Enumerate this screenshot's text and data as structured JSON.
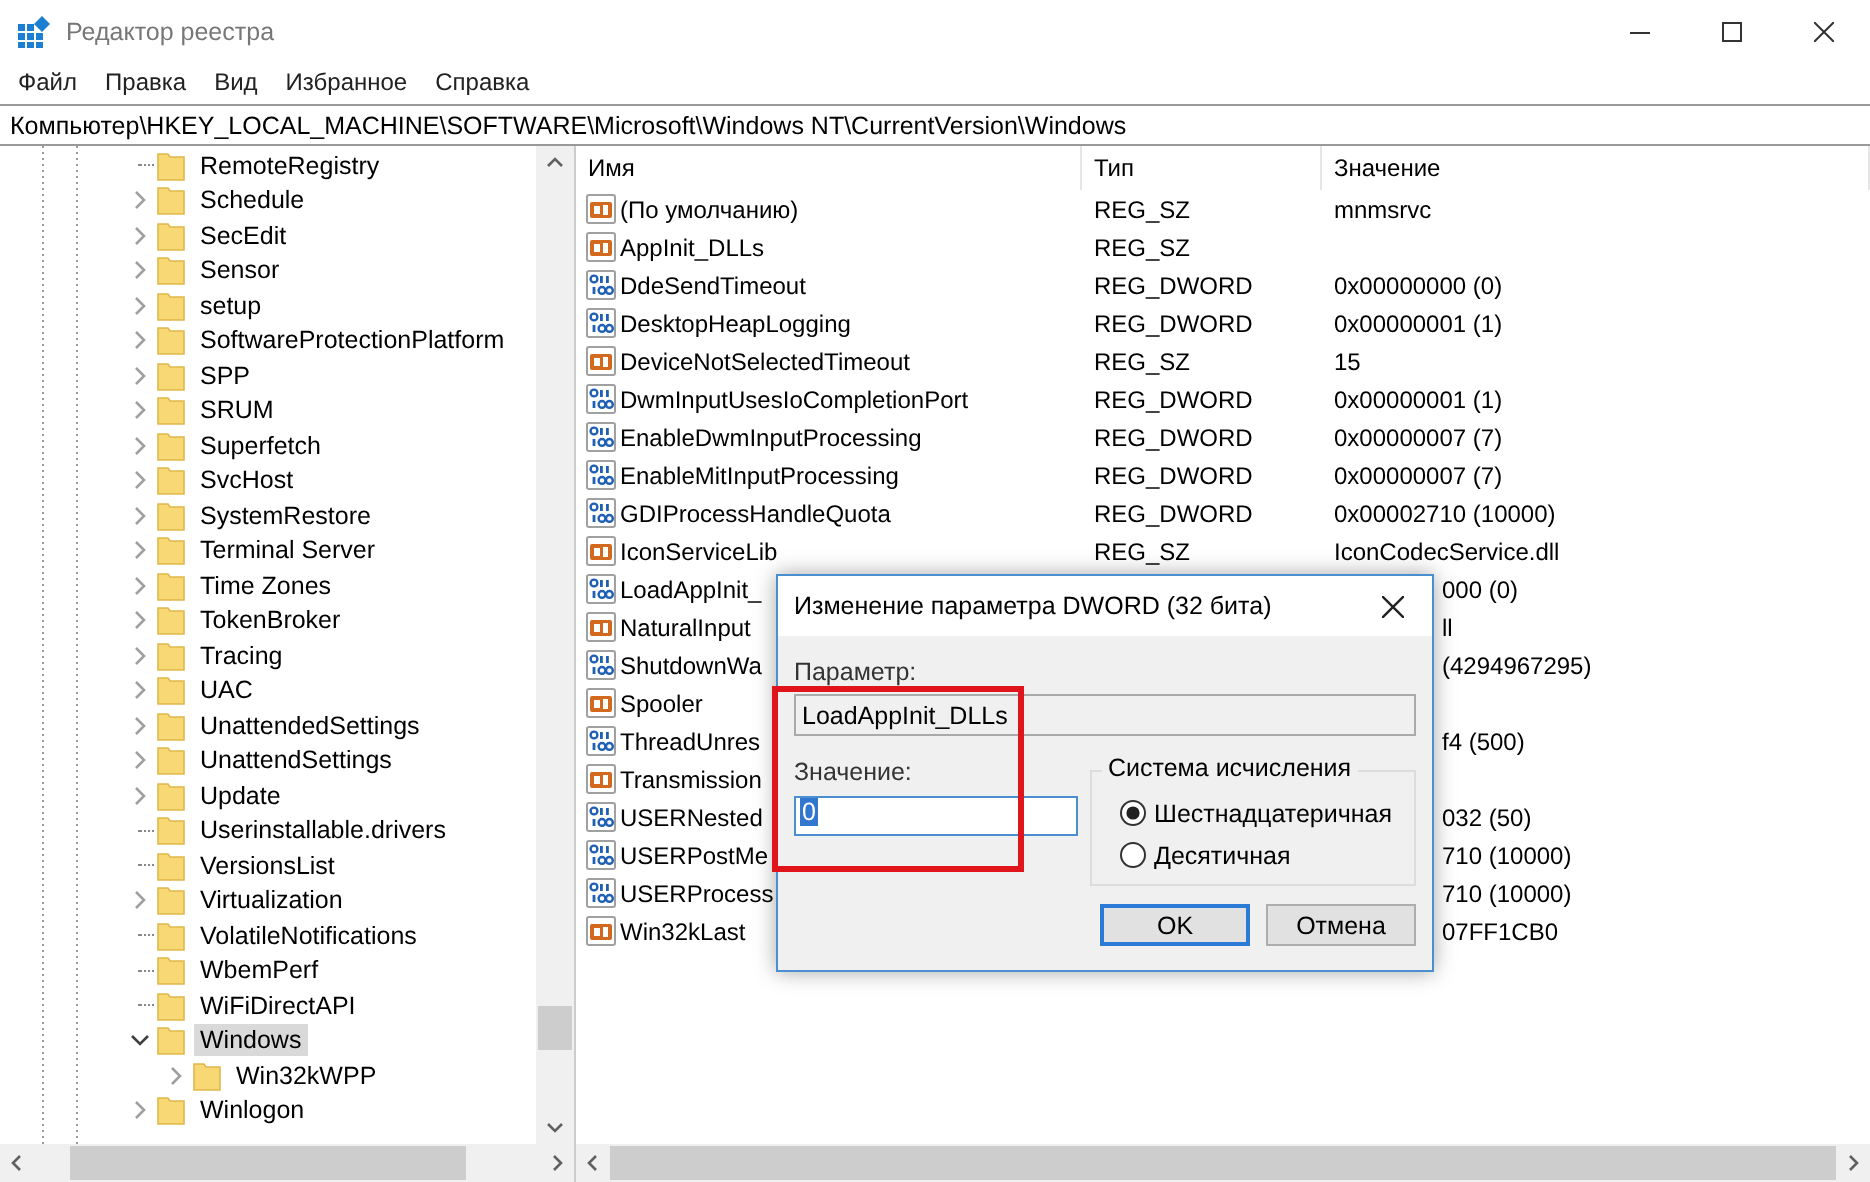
{
  "window": {
    "title": "Редактор реестра"
  },
  "menu": [
    "Файл",
    "Правка",
    "Вид",
    "Избранное",
    "Справка"
  ],
  "address": "Компьютер\\HKEY_LOCAL_MACHINE\\SOFTWARE\\Microsoft\\Windows NT\\CurrentVersion\\Windows",
  "tree": [
    {
      "label": "RemoteRegistry",
      "has_children": false,
      "selected": false
    },
    {
      "label": "Schedule",
      "has_children": true,
      "expanded": false,
      "selected": false
    },
    {
      "label": "SecEdit",
      "has_children": true,
      "expanded": false,
      "selected": false
    },
    {
      "label": "Sensor",
      "has_children": true,
      "expanded": false,
      "selected": false
    },
    {
      "label": "setup",
      "has_children": true,
      "expanded": false,
      "selected": false
    },
    {
      "label": "SoftwareProtectionPlatform",
      "has_children": true,
      "expanded": false,
      "selected": false
    },
    {
      "label": "SPP",
      "has_children": true,
      "expanded": false,
      "selected": false
    },
    {
      "label": "SRUM",
      "has_children": true,
      "expanded": false,
      "selected": false
    },
    {
      "label": "Superfetch",
      "has_children": true,
      "expanded": false,
      "selected": false
    },
    {
      "label": "SvcHost",
      "has_children": true,
      "expanded": false,
      "selected": false
    },
    {
      "label": "SystemRestore",
      "has_children": true,
      "expanded": false,
      "selected": false
    },
    {
      "label": "Terminal Server",
      "has_children": true,
      "expanded": false,
      "selected": false
    },
    {
      "label": "Time Zones",
      "has_children": true,
      "expanded": false,
      "selected": false
    },
    {
      "label": "TokenBroker",
      "has_children": true,
      "expanded": false,
      "selected": false
    },
    {
      "label": "Tracing",
      "has_children": true,
      "expanded": false,
      "selected": false
    },
    {
      "label": "UAC",
      "has_children": true,
      "expanded": false,
      "selected": false
    },
    {
      "label": "UnattendedSettings",
      "has_children": true,
      "expanded": false,
      "selected": false
    },
    {
      "label": "UnattendSettings",
      "has_children": true,
      "expanded": false,
      "selected": false
    },
    {
      "label": "Update",
      "has_children": true,
      "expanded": false,
      "selected": false
    },
    {
      "label": "Userinstallable.drivers",
      "has_children": false,
      "selected": false
    },
    {
      "label": "VersionsList",
      "has_children": false,
      "selected": false
    },
    {
      "label": "Virtualization",
      "has_children": true,
      "expanded": false,
      "selected": false
    },
    {
      "label": "VolatileNotifications",
      "has_children": false,
      "selected": false
    },
    {
      "label": "WbemPerf",
      "has_children": false,
      "selected": false
    },
    {
      "label": "WiFiDirectAPI",
      "has_children": false,
      "selected": false
    },
    {
      "label": "Windows",
      "has_children": true,
      "expanded": true,
      "selected": true,
      "children": [
        {
          "label": "Win32kWPP",
          "has_children": true,
          "expanded": false,
          "selected": false
        }
      ]
    },
    {
      "label": "Winlogon",
      "has_children": true,
      "expanded": false,
      "selected": false
    }
  ],
  "table": {
    "columns": [
      "Имя",
      "Тип",
      "Значение"
    ],
    "rows": [
      {
        "kind": "string",
        "name": "(По умолчанию)",
        "type": "REG_SZ",
        "value": "mnmsrvc"
      },
      {
        "kind": "string",
        "name": "AppInit_DLLs",
        "type": "REG_SZ"
      },
      {
        "kind": "dword",
        "name": "DdeSendTimeout",
        "type": "REG_DWORD",
        "value": "0x00000000 (0)"
      },
      {
        "kind": "dword",
        "name": "DesktopHeapLogging",
        "type": "REG_DWORD",
        "value": "0x00000001 (1)"
      },
      {
        "kind": "string",
        "name": "DeviceNotSelectedTimeout",
        "type": "REG_SZ",
        "value": "15"
      },
      {
        "kind": "dword",
        "name": "DwmInputUsesIoCompletionPort",
        "type": "REG_DWORD",
        "value": "0x00000001 (1)"
      },
      {
        "kind": "dword",
        "name": "EnableDwmInputProcessing",
        "type": "REG_DWORD",
        "value": "0x00000007 (7)"
      },
      {
        "kind": "dword",
        "name": "EnableMitInputProcessing",
        "type": "REG_DWORD",
        "value": "0x00000007 (7)"
      },
      {
        "kind": "dword",
        "name": "GDIProcessHandleQuota",
        "type": "REG_DWORD",
        "value": "0x00002710 (10000)"
      },
      {
        "kind": "string",
        "name": "IconServiceLib",
        "type": "REG_SZ",
        "value": "IconCodecService.dll"
      },
      {
        "kind": "dword",
        "name": "LoadAppInit_",
        "value": "000 (0)"
      },
      {
        "kind": "string",
        "name": "NaturalInput",
        "value": "ll"
      },
      {
        "kind": "dword",
        "name": "ShutdownWa",
        "value": "(4294967295)"
      },
      {
        "kind": "string",
        "name": "Spooler"
      },
      {
        "kind": "dword",
        "name": "ThreadUnres",
        "value": "f4 (500)"
      },
      {
        "kind": "string",
        "name": "Transmission"
      },
      {
        "kind": "dword",
        "name": "USERNested",
        "value": "032 (50)"
      },
      {
        "kind": "dword",
        "name": "USERPostMe",
        "value": "710 (10000)"
      },
      {
        "kind": "dword",
        "name": "USERProcess",
        "value": "710 (10000)"
      },
      {
        "kind": "string",
        "name": "Win32kLast",
        "value": "07FF1CB0"
      }
    ]
  },
  "dialog": {
    "title": "Изменение параметра DWORD (32 бита)",
    "name_label": "Параметр:",
    "name_value": "LoadAppInit_DLLs",
    "value_label": "Значение:",
    "value": "0",
    "base_group": "Система исчисления",
    "bases": [
      {
        "label": "Шестнадцатеричная",
        "selected": true
      },
      {
        "label": "Десятичная",
        "selected": false
      }
    ],
    "buttons": [
      {
        "label": "OK",
        "default": true
      },
      {
        "label": "Отмена",
        "default": false
      }
    ]
  }
}
